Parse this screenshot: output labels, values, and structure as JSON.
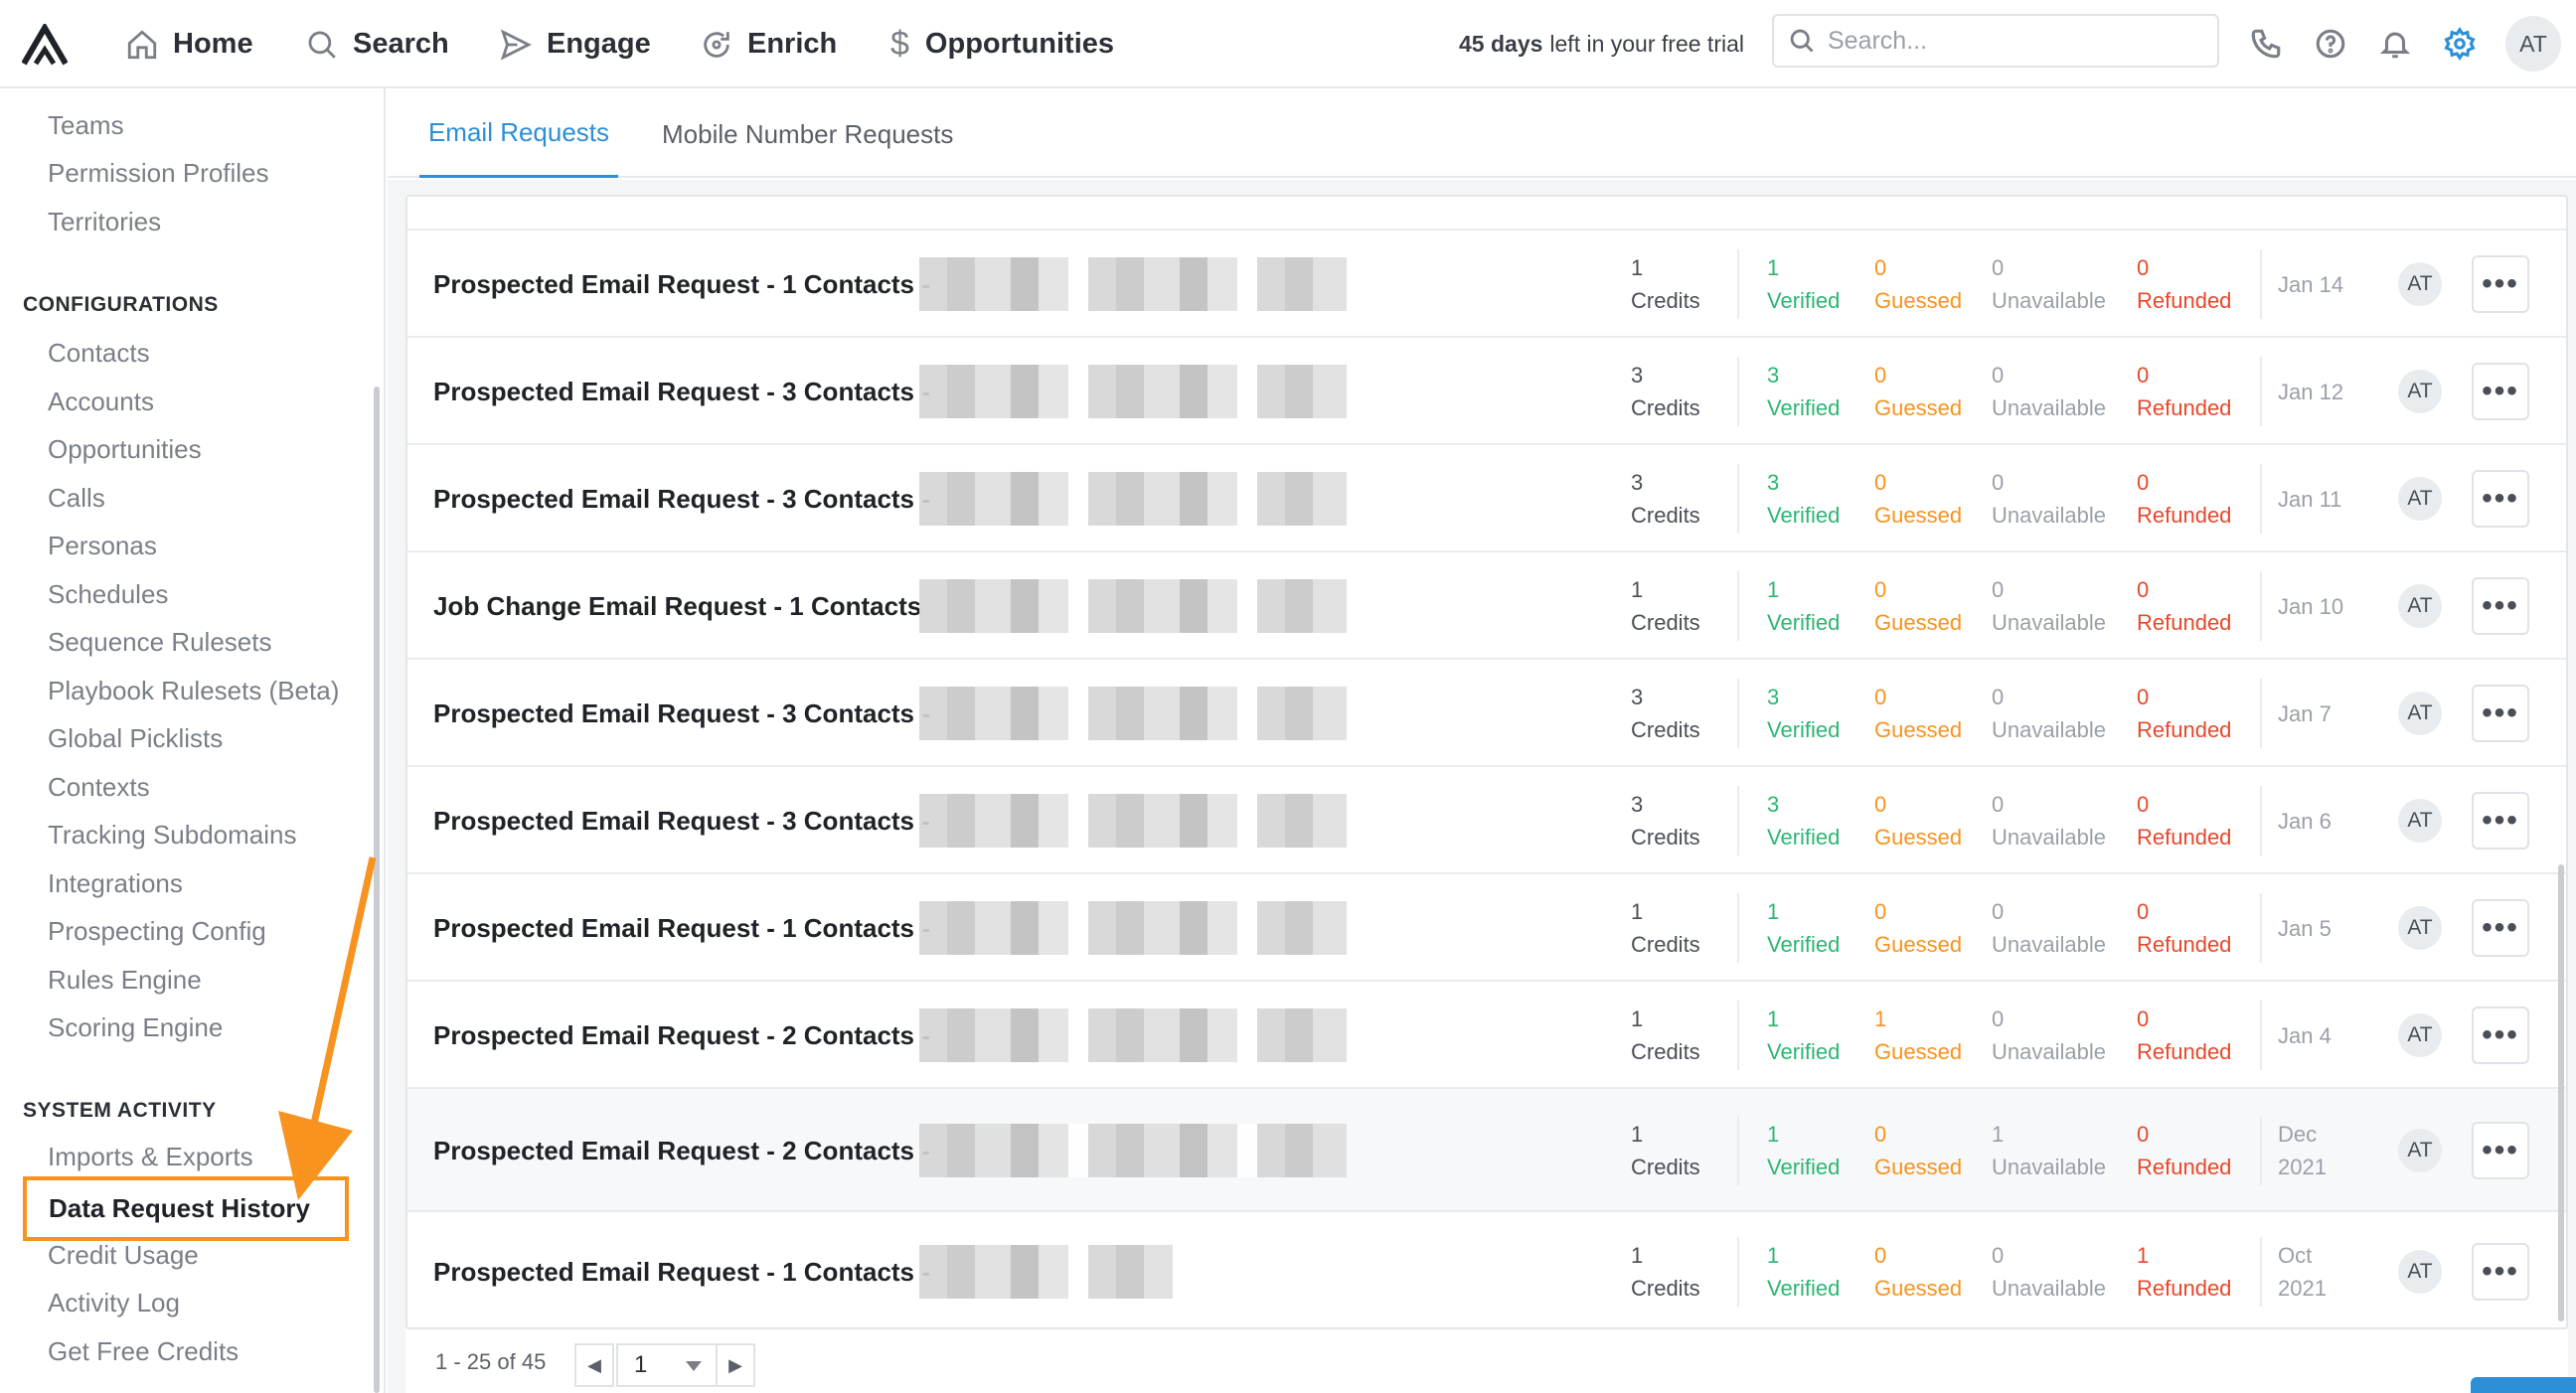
{
  "nav": {
    "items": [
      {
        "label": "Home",
        "icon": "home-icon"
      },
      {
        "label": "Search",
        "icon": "search-icon"
      },
      {
        "label": "Engage",
        "icon": "send-icon"
      },
      {
        "label": "Enrich",
        "icon": "refresh-icon"
      },
      {
        "label": "Opportunities",
        "icon": "dollar-icon"
      }
    ],
    "trial_days": "45 days",
    "trial_rest": "left in your free trial",
    "search_placeholder": "Search...",
    "avatar": "AT",
    "accent_color": "#2d8fd6"
  },
  "sidebar": {
    "top_items": [
      "Teams",
      "Permission Profiles",
      "Territories"
    ],
    "config_heading": "CONFIGURATIONS",
    "config_items": [
      "Contacts",
      "Accounts",
      "Opportunities",
      "Calls",
      "Personas",
      "Schedules",
      "Sequence Rulesets",
      "Playbook Rulesets (Beta)",
      "Global Picklists",
      "Contexts",
      "Tracking Subdomains",
      "Integrations",
      "Prospecting Config",
      "Rules Engine",
      "Scoring Engine"
    ],
    "system_heading": "SYSTEM ACTIVITY",
    "system_items": [
      "Imports & Exports"
    ],
    "active_item": "Data Request History",
    "after_items": [
      "Credit Usage",
      "Activity Log",
      "Get Free Credits"
    ],
    "highlight_color": "#f7931e"
  },
  "tabs": [
    {
      "label": "Email Requests",
      "active": true
    },
    {
      "label": "Mobile Number Requests",
      "active": false
    }
  ],
  "rows": [
    {
      "title": "Prospected Email Request - 1 Contacts -",
      "credits": "1",
      "credits_label": "Credits",
      "verified": "1",
      "verified_label": "Verified",
      "guessed": "0",
      "guessed_label": "Guessed",
      "unavailable": "0",
      "unavailable_label": "Unavailable",
      "refunded": "0",
      "refunded_label": "Refunded",
      "date1": "Jan 14",
      "date2": "",
      "owner": "AT"
    },
    {
      "title": "Prospected Email Request - 3 Contacts -",
      "credits": "3",
      "credits_label": "Credits",
      "verified": "3",
      "verified_label": "Verified",
      "guessed": "0",
      "guessed_label": "Guessed",
      "unavailable": "0",
      "unavailable_label": "Unavailable",
      "refunded": "0",
      "refunded_label": "Refunded",
      "date1": "Jan 12",
      "date2": "",
      "owner": "AT"
    },
    {
      "title": "Prospected Email Request - 3 Contacts -",
      "credits": "3",
      "credits_label": "Credits",
      "verified": "3",
      "verified_label": "Verified",
      "guessed": "0",
      "guessed_label": "Guessed",
      "unavailable": "0",
      "unavailable_label": "Unavailable",
      "refunded": "0",
      "refunded_label": "Refunded",
      "date1": "Jan 11",
      "date2": "",
      "owner": "AT"
    },
    {
      "title": "Job Change Email Request - 1 Contacts",
      "credits": "1",
      "credits_label": "Credits",
      "verified": "1",
      "verified_label": "Verified",
      "guessed": "0",
      "guessed_label": "Guessed",
      "unavailable": "0",
      "unavailable_label": "Unavailable",
      "refunded": "0",
      "refunded_label": "Refunded",
      "date1": "Jan 10",
      "date2": "",
      "owner": "AT"
    },
    {
      "title": "Prospected Email Request - 3 Contacts -",
      "credits": "3",
      "credits_label": "Credits",
      "verified": "3",
      "verified_label": "Verified",
      "guessed": "0",
      "guessed_label": "Guessed",
      "unavailable": "0",
      "unavailable_label": "Unavailable",
      "refunded": "0",
      "refunded_label": "Refunded",
      "date1": "Jan 7",
      "date2": "",
      "owner": "AT"
    },
    {
      "title": "Prospected Email Request - 3 Contacts -",
      "credits": "3",
      "credits_label": "Credits",
      "verified": "3",
      "verified_label": "Verified",
      "guessed": "0",
      "guessed_label": "Guessed",
      "unavailable": "0",
      "unavailable_label": "Unavailable",
      "refunded": "0",
      "refunded_label": "Refunded",
      "date1": "Jan 6",
      "date2": "",
      "owner": "AT"
    },
    {
      "title": "Prospected Email Request - 1 Contacts -",
      "credits": "1",
      "credits_label": "Credits",
      "verified": "1",
      "verified_label": "Verified",
      "guessed": "0",
      "guessed_label": "Guessed",
      "unavailable": "0",
      "unavailable_label": "Unavailable",
      "refunded": "0",
      "refunded_label": "Refunded",
      "date1": "Jan 5",
      "date2": "",
      "owner": "AT"
    },
    {
      "title": "Prospected Email Request - 2 Contacts -",
      "credits": "1",
      "credits_label": "Credits",
      "verified": "1",
      "verified_label": "Verified",
      "guessed": "1",
      "guessed_label": "Guessed",
      "unavailable": "0",
      "unavailable_label": "Unavailable",
      "refunded": "0",
      "refunded_label": "Refunded",
      "date1": "Jan 4",
      "date2": "",
      "owner": "AT"
    },
    {
      "title": "Prospected Email Request - 2 Contacts -",
      "credits": "1",
      "credits_label": "Credits",
      "verified": "1",
      "verified_label": "Verified",
      "guessed": "0",
      "guessed_label": "Guessed",
      "unavailable": "1",
      "unavailable_label": "Unavailable",
      "refunded": "0",
      "refunded_label": "Refunded",
      "date1": "Dec",
      "date2": "2021",
      "owner": "AT"
    },
    {
      "title": "Prospected Email Request - 1 Contacts -",
      "credits": "1",
      "credits_label": "Credits",
      "verified": "1",
      "verified_label": "Verified",
      "guessed": "0",
      "guessed_label": "Guessed",
      "unavailable": "0",
      "unavailable_label": "Unavailable",
      "refunded": "1",
      "refunded_label": "Refunded",
      "date1": "Oct",
      "date2": "2021",
      "owner": "AT"
    }
  ],
  "more_label": "•••",
  "pagination": {
    "range": "1 - 25 of 45",
    "page": "1"
  }
}
